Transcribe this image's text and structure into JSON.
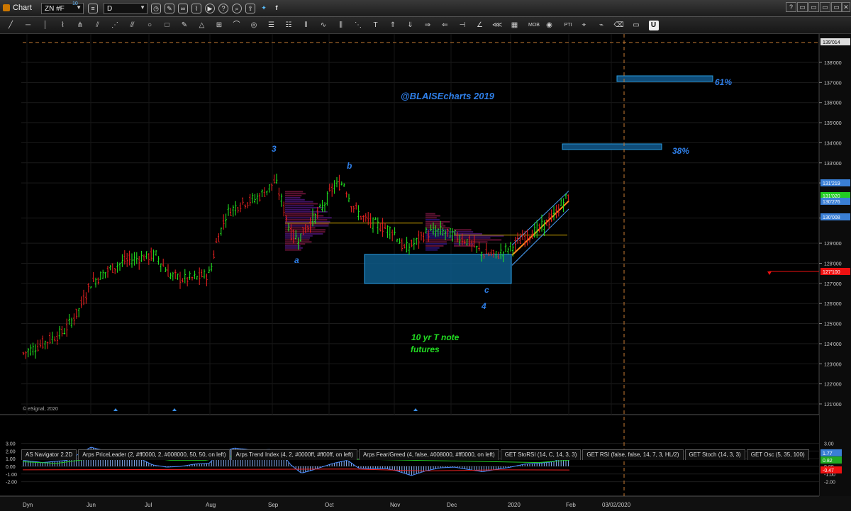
{
  "window": {
    "title": "Chart",
    "symbol_input": "ZN #F",
    "symbol_badge": "10",
    "interval_input": "D",
    "window_buttons": [
      "?",
      "▭",
      "▭",
      "▭",
      "▭",
      "✕"
    ]
  },
  "toolbar": {
    "tools": [
      "line-tool",
      "horizontal-line-tool",
      "vertical-line-tool",
      "polyline-tool",
      "pitchfork-tool",
      "fibonacci-tool",
      "fan-tool",
      "regression-tool",
      "ellipse-tool",
      "rectangle-tool",
      "brush-tool",
      "triangle-tool",
      "gann-tool",
      "arc-tool",
      "spiral-tool",
      "fib-retracement-tool",
      "fib-extension-tool",
      "cycle-lines-tool",
      "wave-tool",
      "trend-channel-tool",
      "speed-lines-tool",
      "text-tool",
      "arrow-up-tool",
      "arrow-down-tool",
      "arrow-right-tool",
      "arrow-left-tool",
      "price-marker-tool",
      "angle-tool",
      "chevron-tool",
      "grid-tool",
      "mob-tool",
      "eye-tool",
      "pattern-tool",
      "measure-tool",
      "sketch-tool",
      "eraser-tool",
      "comment-tool",
      "magnet-tool"
    ],
    "mob_label": "MOB",
    "pattern_label": "PTI"
  },
  "chart": {
    "watermark": "@BLAISEcharts 2019",
    "copyright": "© eSignal, 2020",
    "annotations": {
      "wave_3": "3",
      "wave_b": "b",
      "wave_a": "a",
      "wave_c": "c",
      "wave_4": "4",
      "fib_61": "61%",
      "fib_38": "38%",
      "instrument_line1": "10 yr T note",
      "instrument_line2": "futures"
    },
    "price_axis": [
      "138'000",
      "137'000",
      "136'000",
      "135'000",
      "134'000",
      "133'000",
      "132'000",
      "130'008",
      "129'000",
      "128'000",
      "127'000",
      "126'000",
      "125'000",
      "124'000",
      "123'000",
      "122'000",
      "121'000"
    ],
    "price_tags": {
      "top": "139'014",
      "t1": "131'219",
      "t2": "131'020",
      "t3": "130'276",
      "t4": "130'008",
      "t5": "127'100"
    },
    "date_axis": [
      "Dyn",
      "Jun",
      "Jul",
      "Aug",
      "Sep",
      "Oct",
      "Nov",
      "Dec",
      "2020",
      "Feb",
      "03/02/2020"
    ],
    "colors": {
      "up_bar": "#22ee22",
      "down_bar": "#ee2222",
      "moving_average": "#3a7fd5",
      "fib_box": "#1f86c8",
      "annotation_blue": "#2f7fe8",
      "annotation_green": "#22dd22",
      "orange_line": "#ff8a1a",
      "red_marker": "#ee1111"
    }
  },
  "indicator": {
    "tabs": [
      "AS Navigator 2.2D",
      "Arps PriceLeader (2, #ff0000, 2, #008000, 50, 50, on left)",
      "Arps Trend Index (4, 2, #0000ff, #ff00ff, on left)",
      "Arps Fear/Greed (4, false, #008000, #ff0000, on left)",
      "GET StoRSI (14, C, 14, 3, 3)",
      "GET RSI (false, false, 14, 7, 3, HL/2)",
      "GET Stoch (14, 3, 3)",
      "GET Osc (5, 35, 100)"
    ],
    "y_axis": [
      "3.00",
      "2.00",
      "1.00",
      "0.00",
      "-1.00",
      "-2.00"
    ],
    "value_tags": {
      "v1": "1.77",
      "v2": "0.82",
      "v3": "0.00",
      "v4": "-0.47"
    }
  }
}
